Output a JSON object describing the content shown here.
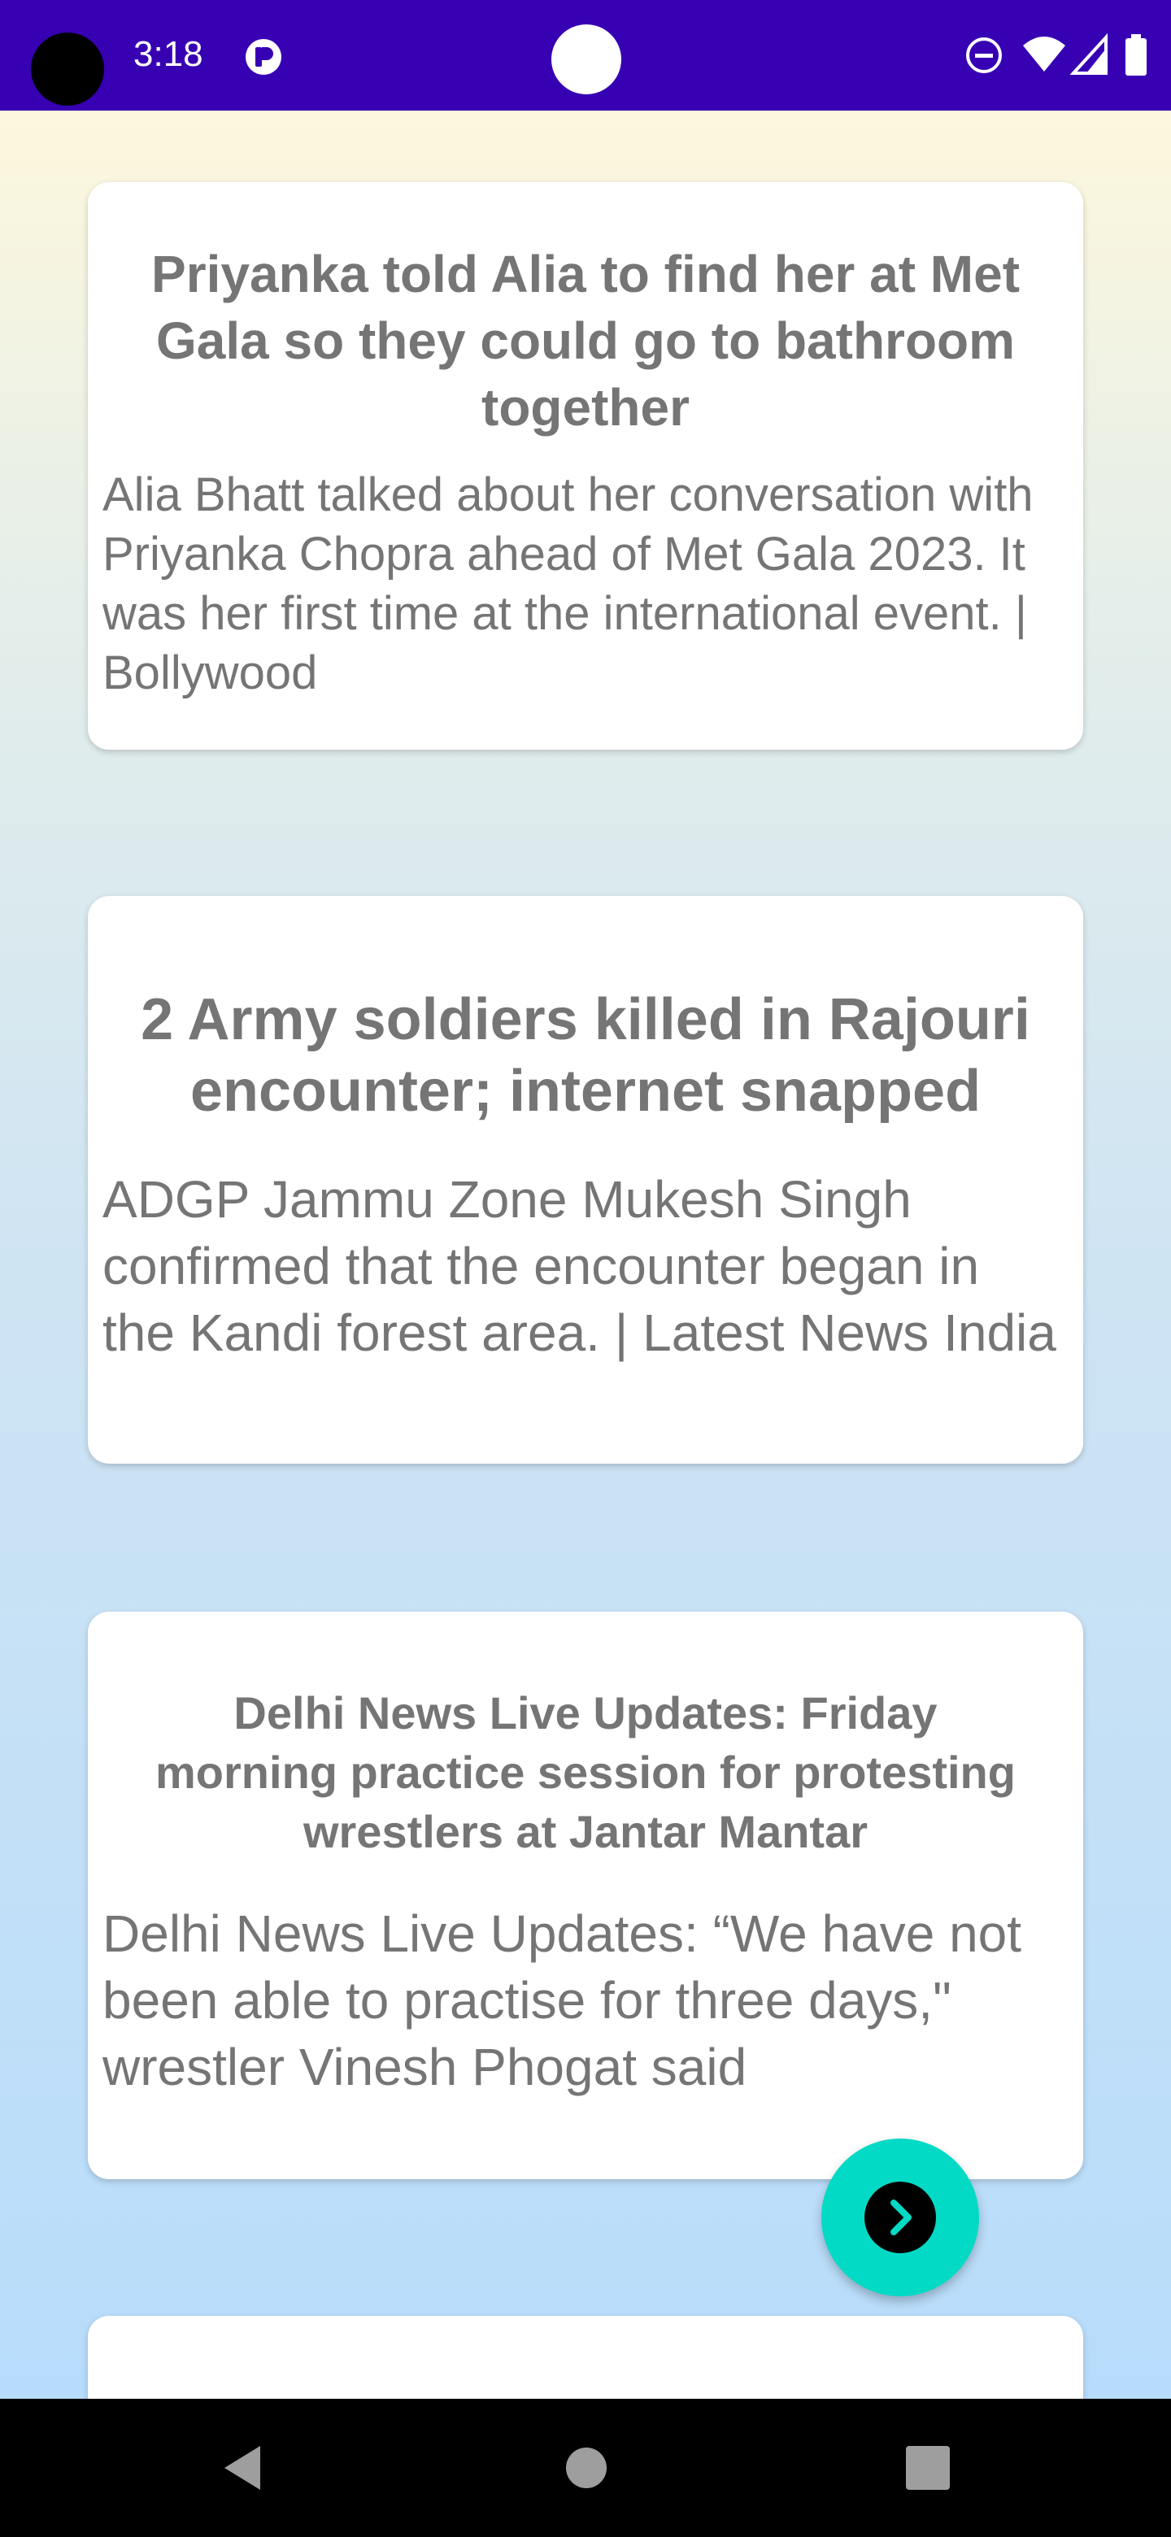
{
  "status_bar": {
    "time": "3:18",
    "background_color": "#3700b3",
    "icons": [
      "app-notification-icon",
      "do-not-disturb-icon",
      "wifi-icon",
      "signal-icon",
      "battery-icon"
    ]
  },
  "articles": [
    {
      "title": "Priyanka told Alia to find her at Met Gala so they could go to bathroom together",
      "description": "Alia Bhatt talked about her conversation with Priyanka Chopra ahead of Met Gala 2023. It was her first time at the international event. | Bollywood"
    },
    {
      "title": "2 Army soldiers killed in Rajouri encounter; internet snapped",
      "description": "ADGP Jammu Zone Mukesh Singh confirmed that the encounter began in the Kandi forest area. | Latest News India"
    },
    {
      "title": "Delhi News Live Updates: Friday morning practice session for protesting wrestlers at Jantar Mantar",
      "description": "Delhi News Live Updates: “We have not been able to practise for three days,\" wrestler Vinesh Phogat said"
    }
  ],
  "fab": {
    "icon": "chevron-right-icon",
    "color": "#03dac5"
  },
  "navigation_bar": {
    "buttons": [
      "back-icon",
      "home-icon",
      "recents-icon"
    ]
  }
}
